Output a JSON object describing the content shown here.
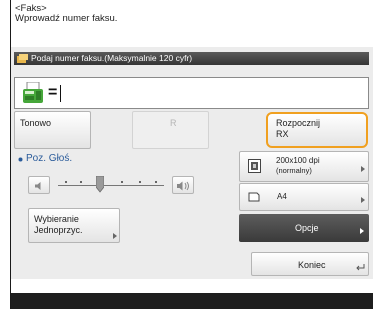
{
  "header": {
    "line1": "<Faks>",
    "line2": "Wprowadź numer faksu."
  },
  "input_bar": {
    "label": "Podaj numer faksu.(Maksymalnie 120 cyfr)"
  },
  "input": {
    "prefix": "=",
    "value": ""
  },
  "buttons": {
    "tonowo": "Tonowo",
    "r": "R",
    "rozpocznij_line1": "Rozpocznij",
    "rozpocznij_line2": "RX",
    "resolution_line1": "200x100 dpi",
    "resolution_line2": "(normalny)",
    "paper": "A4",
    "opcje": "Opcje",
    "wybieranie_line1": "Wybieranie",
    "wybieranie_line2": "Jednoprzyc.",
    "koniec": "Koniec"
  },
  "volume": {
    "label": "Poz. Głoś.",
    "level_fraction": 0.4
  },
  "colors": {
    "highlight": "#f0a020",
    "accent_blue": "#2a5b9a",
    "bar_dark": "#3a3a3a"
  },
  "icons": [
    "fax-machine-icon",
    "volume-low-icon",
    "volume-high-icon",
    "resolution-icon",
    "paper-icon",
    "return-icon"
  ]
}
